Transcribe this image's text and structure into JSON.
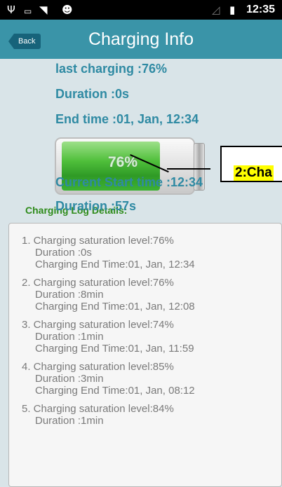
{
  "statusbar": {
    "time": "12:35",
    "icons": [
      "usb-icon",
      "battery-icon",
      "wifi-icon",
      "android-icon",
      "signal-icon",
      "sim-icon"
    ]
  },
  "appbar": {
    "back_label": "Back",
    "title": "Charging Info"
  },
  "info": {
    "last_charging": "last charging :76%",
    "duration": "Duration :0s",
    "end_time": "End time :01, Jan, 12:34",
    "current_start": "Current Start time :12:34",
    "current_duration": "Duration :57s"
  },
  "battery": {
    "level_label": "76%",
    "level_fraction": 0.76
  },
  "callout": {
    "text": "2:Cha"
  },
  "log": {
    "title": "Charging Log Details:",
    "entries": [
      {
        "line1": "1. Charging saturation level:76%",
        "line2": "Duration :0s",
        "line3": "Charging End Time:01, Jan, 12:34"
      },
      {
        "line1": "2. Charging saturation level:76%",
        "line2": "Duration :8min",
        "line3": "Charging End Time:01, Jan, 12:08"
      },
      {
        "line1": "3. Charging saturation level:74%",
        "line2": "Duration :1min",
        "line3": "Charging End Time:01, Jan, 11:59"
      },
      {
        "line1": "4. Charging saturation level:85%",
        "line2": "Duration :3min",
        "line3": "Charging End Time:01, Jan, 08:12"
      },
      {
        "line1": "5. Charging saturation level:84%",
        "line2": "Duration :1min",
        "line3": ""
      }
    ]
  }
}
